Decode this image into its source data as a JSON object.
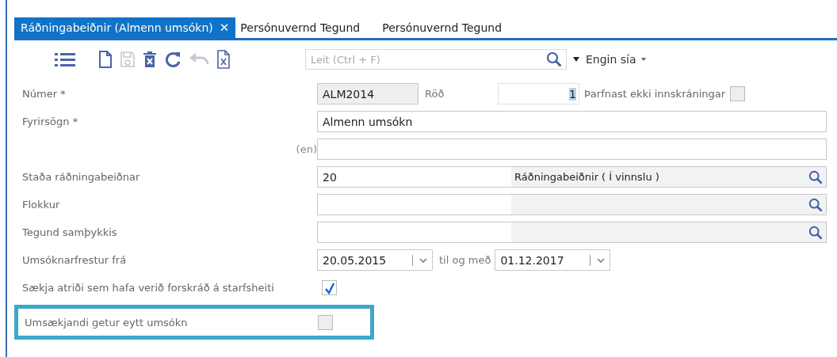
{
  "tabs": [
    {
      "label": "Ráðningabeiðnir (Almenn umsókn)",
      "selected": true,
      "close": "✕"
    },
    {
      "label": "Persónuvernd Tegund",
      "selected": false
    },
    {
      "label": "Persónuvernd Tegund",
      "selected": false
    }
  ],
  "toolbar": [
    {
      "kind": "list",
      "disabled": false
    },
    {
      "kind": "new",
      "disabled": false
    },
    {
      "kind": "save",
      "disabled": true
    },
    {
      "kind": "delete",
      "disabled": false
    },
    {
      "kind": "refresh",
      "disabled": false
    },
    {
      "kind": "undo",
      "disabled": true
    },
    {
      "kind": "excel",
      "disabled": false
    }
  ],
  "search": {
    "placeholder": "Leit (Ctrl + F)",
    "filter": "Engin sía"
  },
  "form": [
    {
      "kind": "number",
      "label": "Númer *",
      "value": "ALM2014",
      "order_label": "Röð",
      "order_value": "1",
      "extra_label": "Þarfnast ekki innskráningar",
      "extra_checked": false
    },
    {
      "kind": "text",
      "label": "Fyrirsögn *",
      "value": "Almenn umsókn"
    },
    {
      "kind": "text",
      "suffix": "(en)"
    },
    {
      "kind": "lookup",
      "label": "Staða ráðningabeiðnar",
      "code": "20",
      "description": "Ráðningabeiðnir ( Í vinnslu )"
    },
    {
      "kind": "lookup",
      "label": "Flokkur"
    },
    {
      "kind": "lookup",
      "label": "Tegund samþykkis"
    },
    {
      "kind": "daterange",
      "label": "Umsóknarfrestur frá",
      "from": "20.05.2015",
      "to_label": "til og með",
      "to": "01.12.2017"
    },
    {
      "kind": "checkbox",
      "label": "Sækja atriði sem hafa verið forskráð á starfsheiti",
      "checked": true,
      "highlighted": false
    },
    {
      "kind": "checkbox",
      "label": "Umsækjandi getur eytt umsókn",
      "checked": false,
      "highlighted": true
    }
  ]
}
